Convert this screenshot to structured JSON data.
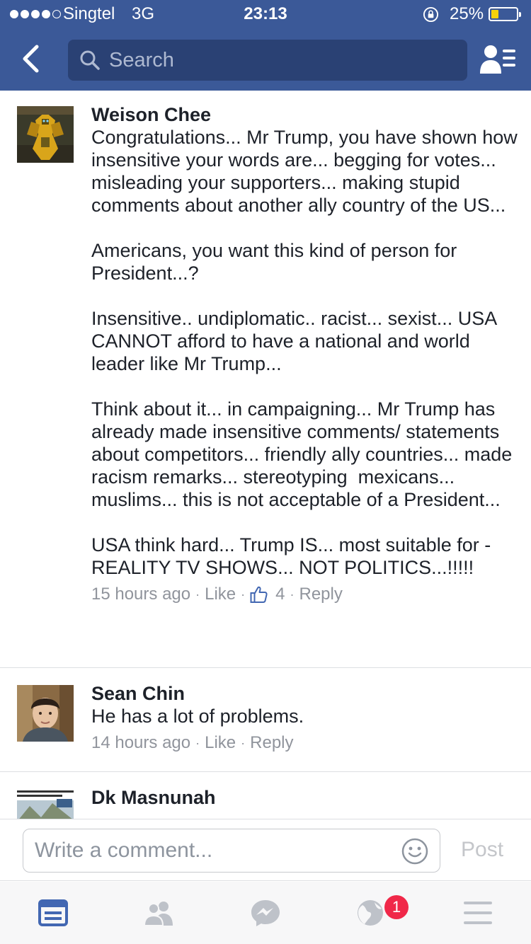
{
  "status_bar": {
    "carrier": "Singtel",
    "network": "3G",
    "time": "23:13",
    "battery_percent": "25%",
    "battery_level": 0.25,
    "signal_bars": 4,
    "signal_total": 5
  },
  "nav": {
    "search_placeholder": "Search",
    "back_icon": "chevron-left-icon",
    "profile_icon": "friend-requests-icon"
  },
  "comments": [
    {
      "author": "Weison Chee",
      "text": "Congratulations... Mr Trump, you have shown how insensitive your words are... begging for votes... misleading your supporters... making stupid comments about another ally country of the US...\n\nAmericans, you want this kind of person for President...?\n\nInsensitive.. undiplomatic.. racist... sexist... USA CANNOT afford to have a national and world leader like Mr Trump...\n\nThink about it... in campaigning... Mr Trump has already made insensitive comments/ statements about competitors... friendly ally countries... made racism remarks... stereotyping  mexicans... muslims... this is not acceptable of a President...\n\nUSA think hard... Trump IS... most suitable for - REALITY TV SHOWS... NOT POLITICS...!!!!!",
      "time": "15 hours ago",
      "like_label": "Like",
      "like_count": "4",
      "reply_label": "Reply"
    },
    {
      "author": "Sean Chin",
      "text": "He has a lot of problems.",
      "time": "14 hours ago",
      "like_label": "Like",
      "reply_label": "Reply"
    },
    {
      "author": "Dk Masnunah"
    }
  ],
  "composer": {
    "placeholder": "Write a comment...",
    "post_label": "Post",
    "emoji_icon": "smiley-icon"
  },
  "tab_bar": {
    "tabs": [
      "news-feed-icon",
      "friends-icon",
      "messenger-icon",
      "notifications-globe-icon",
      "menu-icon"
    ],
    "active_tab": "news-feed-icon",
    "notification_badge": "1"
  },
  "colors": {
    "header_blue": "#3b5998",
    "search_bg": "#2a4174",
    "active_tab": "#4267b2",
    "inactive_tab": "#bec2c9",
    "badge_red": "#f02849",
    "meta_gray": "#90949c"
  }
}
